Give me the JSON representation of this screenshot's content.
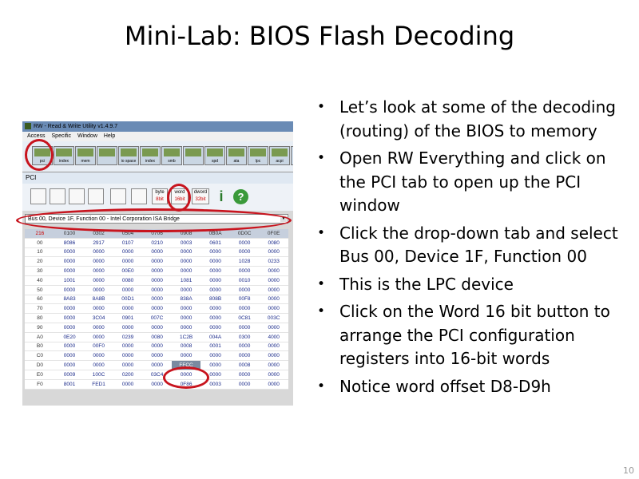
{
  "slide": {
    "title": "Mini-Lab: BIOS Flash Decoding",
    "page_number": "10",
    "bullets": [
      "Let’s look at some of the decoding (routing) of the BIOS to memory",
      "Open RW Everything and click on the PCI tab to open up the PCI window",
      "Click the drop-down tab and select Bus 00, Device 1F, Function 00",
      "This is the LPC device",
      "Click on the Word 16 bit button to arrange the PCI configuration registers into 16-bit words",
      "Notice word offset D8-D9h"
    ],
    "bullet_glyph": "•"
  },
  "screenshot": {
    "window_title": "RW - Read & Write Utility v1.4.9.7",
    "menu": [
      "Access",
      "Specific",
      "Window",
      "Help"
    ],
    "toolbar_buttons": [
      "pci",
      "index",
      "mem",
      "",
      "io space",
      "index",
      "smb",
      "",
      "spd",
      "ata",
      "lpc",
      "acpi",
      "ec"
    ],
    "pci_window_title": "PCI",
    "pci_toolbar": {
      "byte_top": "byte",
      "byte_bottom": "8bit",
      "word_top": "word",
      "word_bottom": "16bit",
      "dword_top": "dword",
      "dword_bottom": "32bit",
      "info_glyph": "i",
      "help_glyph": "?"
    },
    "dropdown_value": "Bus 00, Device 1F, Function 00 - Intel Corporation ISA Bridge",
    "table": {
      "corner": "216",
      "columns": [
        "0100",
        "0302",
        "0504",
        "0706",
        "0908",
        "0B0A",
        "0D0C",
        "0F0E"
      ],
      "rows": [
        {
          "offset": "00",
          "cells": [
            "8086",
            "2917",
            "0107",
            "0210",
            "0003",
            "0601",
            "0000",
            "0080"
          ]
        },
        {
          "offset": "10",
          "cells": [
            "0000",
            "0000",
            "0000",
            "0000",
            "0000",
            "0000",
            "0000",
            "0000"
          ]
        },
        {
          "offset": "20",
          "cells": [
            "0000",
            "0000",
            "0000",
            "0000",
            "0000",
            "0000",
            "1028",
            "0233"
          ]
        },
        {
          "offset": "30",
          "cells": [
            "0000",
            "0000",
            "00E0",
            "0000",
            "0000",
            "0000",
            "0000",
            "0000"
          ]
        },
        {
          "offset": "40",
          "cells": [
            "1001",
            "0000",
            "0080",
            "0000",
            "1081",
            "0000",
            "0010",
            "0000"
          ]
        },
        {
          "offset": "50",
          "cells": [
            "0000",
            "0000",
            "0000",
            "0000",
            "0000",
            "0000",
            "0000",
            "0000"
          ]
        },
        {
          "offset": "60",
          "cells": [
            "8A83",
            "8A8B",
            "00D1",
            "0000",
            "838A",
            "808B",
            "00F8",
            "0000"
          ]
        },
        {
          "offset": "70",
          "cells": [
            "0000",
            "0000",
            "0000",
            "0000",
            "0000",
            "0000",
            "0000",
            "0000"
          ]
        },
        {
          "offset": "80",
          "cells": [
            "0000",
            "3C04",
            "0901",
            "007C",
            "0000",
            "0000",
            "0C81",
            "003C"
          ]
        },
        {
          "offset": "90",
          "cells": [
            "0000",
            "0000",
            "0000",
            "0000",
            "0000",
            "0000",
            "0000",
            "0000"
          ]
        },
        {
          "offset": "A0",
          "cells": [
            "0E20",
            "0000",
            "0239",
            "0080",
            "1C2B",
            "004A",
            "0300",
            "4000"
          ]
        },
        {
          "offset": "B0",
          "cells": [
            "0000",
            "00F0",
            "0000",
            "0000",
            "0008",
            "0001",
            "0000",
            "0000"
          ]
        },
        {
          "offset": "C0",
          "cells": [
            "0000",
            "0000",
            "0000",
            "0000",
            "0000",
            "0000",
            "0000",
            "0000"
          ]
        },
        {
          "offset": "D0",
          "cells": [
            "0000",
            "0000",
            "0000",
            "0000",
            "FFCC",
            "0000",
            "0008",
            "0000"
          ]
        },
        {
          "offset": "E0",
          "cells": [
            "0009",
            "100C",
            "0200",
            "03C4",
            "0000",
            "0000",
            "0000",
            "0000"
          ]
        },
        {
          "offset": "F0",
          "cells": [
            "8001",
            "FED1",
            "0000",
            "0000",
            "0F86",
            "0003",
            "0000",
            "0000"
          ]
        }
      ],
      "selected": {
        "row": 13,
        "col": 4
      }
    },
    "annotation_color": "#c8141e"
  }
}
